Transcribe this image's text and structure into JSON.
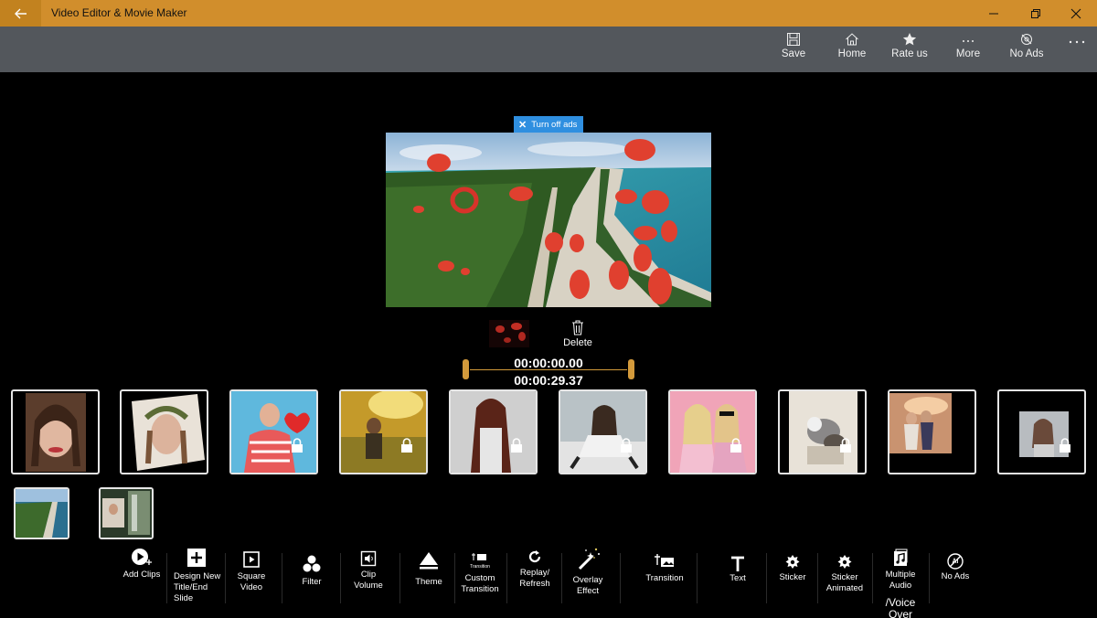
{
  "window": {
    "title": "Video Editor & Movie Maker"
  },
  "appbar": {
    "save": "Save",
    "home": "Home",
    "rate": "Rate us",
    "more": "More",
    "no_ads": "No Ads"
  },
  "ad": {
    "label": "Turn off ads"
  },
  "clip_controls": {
    "delete": "Delete",
    "start_time": "00:00:00.00",
    "end_time": "00:00:29.37"
  },
  "themes": [
    {
      "locked": false
    },
    {
      "locked": false
    },
    {
      "locked": true
    },
    {
      "locked": true
    },
    {
      "locked": true
    },
    {
      "locked": true
    },
    {
      "locked": true
    },
    {
      "locked": true
    },
    {
      "locked": false
    },
    {
      "locked": true
    }
  ],
  "toolbar": {
    "add_clips": "Add Clips",
    "design_new": "Design New\nTitle/End\nSlide",
    "square_video": "Square\nVideo",
    "filter": "Filter",
    "clip_volume": "Clip\nVolume",
    "theme": "Theme",
    "custom_transition": "Custom\nTransition",
    "custom_transition_icon_text": "Transition",
    "replay_refresh": "Replay/\nRefresh",
    "overlay_effect": "Overlay\nEffect",
    "transition": "Transition",
    "text": "Text",
    "sticker": "Sticker",
    "sticker_animated": "Sticker\nAnimated",
    "multiple_audio": "Multiple\nAudio",
    "voice_over": "/Voice\nOver",
    "no_ads": "No Ads"
  },
  "colors": {
    "titlebar": "#d18e2c",
    "appbar": "#53575c",
    "accent": "#2f8fe0",
    "trim": "#d39a3b"
  }
}
